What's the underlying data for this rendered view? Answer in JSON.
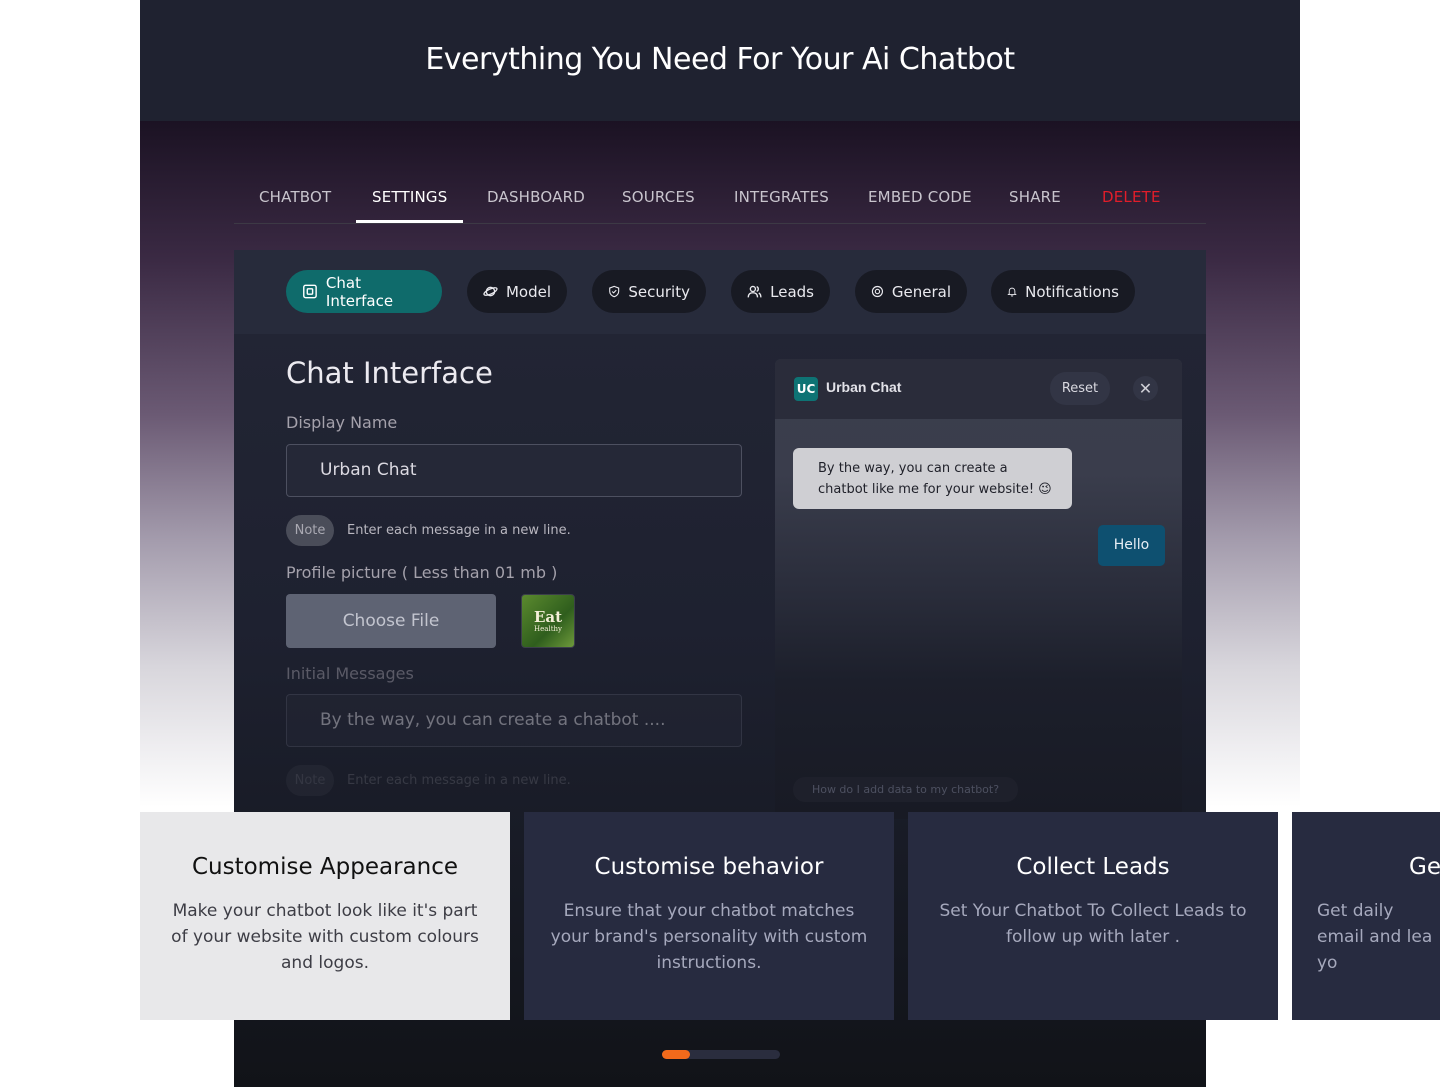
{
  "hero": {
    "title": "Everything You Need For Your Ai Chatbot"
  },
  "tabs": [
    {
      "label": "CHATBOT"
    },
    {
      "label": "SETTINGS"
    },
    {
      "label": "DASHBOARD"
    },
    {
      "label": "SOURCES"
    },
    {
      "label": "INTEGRATES"
    },
    {
      "label": "EMBED CODE"
    },
    {
      "label": "SHARE"
    },
    {
      "label": "DELETE"
    }
  ],
  "subnav": [
    {
      "label": "Chat Interface",
      "icon": "chat-interface-icon"
    },
    {
      "label": "Model",
      "icon": "planet-icon"
    },
    {
      "label": "Security",
      "icon": "shield-check-icon"
    },
    {
      "label": "Leads",
      "icon": "users-icon"
    },
    {
      "label": "General",
      "icon": "target-icon"
    },
    {
      "label": "Notifications",
      "icon": "bell-icon"
    }
  ],
  "form": {
    "title": "Chat Interface",
    "display_name_label": "Display Name",
    "display_name_value": "Urban Chat",
    "note_chip": "Note",
    "note_text": "Enter each message in a new line.",
    "profile_label": "Profile picture ( Less than 01 mb )",
    "choose_file": "Choose File",
    "thumb_word1": "Eat",
    "thumb_word2": "Healthy",
    "initial_label": "Initial Messages",
    "initial_value": "By the way, you can create a chatbot ....",
    "note_chip_2": "Note",
    "note_text_2": "Enter each message in a new line."
  },
  "chat_preview": {
    "logo": "UC",
    "name": "Urban Chat",
    "reset": "Reset",
    "close": "✕",
    "bot_message": "By the way, you can create a chatbot like me for your website! 😉",
    "user_message": "Hello",
    "suggestion": "How do I add data to my chatbot?"
  },
  "cards": [
    {
      "title": "Customise Appearance",
      "body": "Make your chatbot look like it's part of your website with custom colours and logos."
    },
    {
      "title": "Customise behavior",
      "body": "Ensure that your chatbot matches your brand's personality with custom instructions."
    },
    {
      "title": "Collect Leads",
      "body": "Set Your Chatbot To Collect Leads to follow up with later ."
    },
    {
      "title": "Ge",
      "body": "Get daily email and lea yo"
    }
  ],
  "colors": {
    "accent": "#0f6b6b",
    "danger": "#e11d2a",
    "scroll_thumb": "#f26a1b"
  }
}
